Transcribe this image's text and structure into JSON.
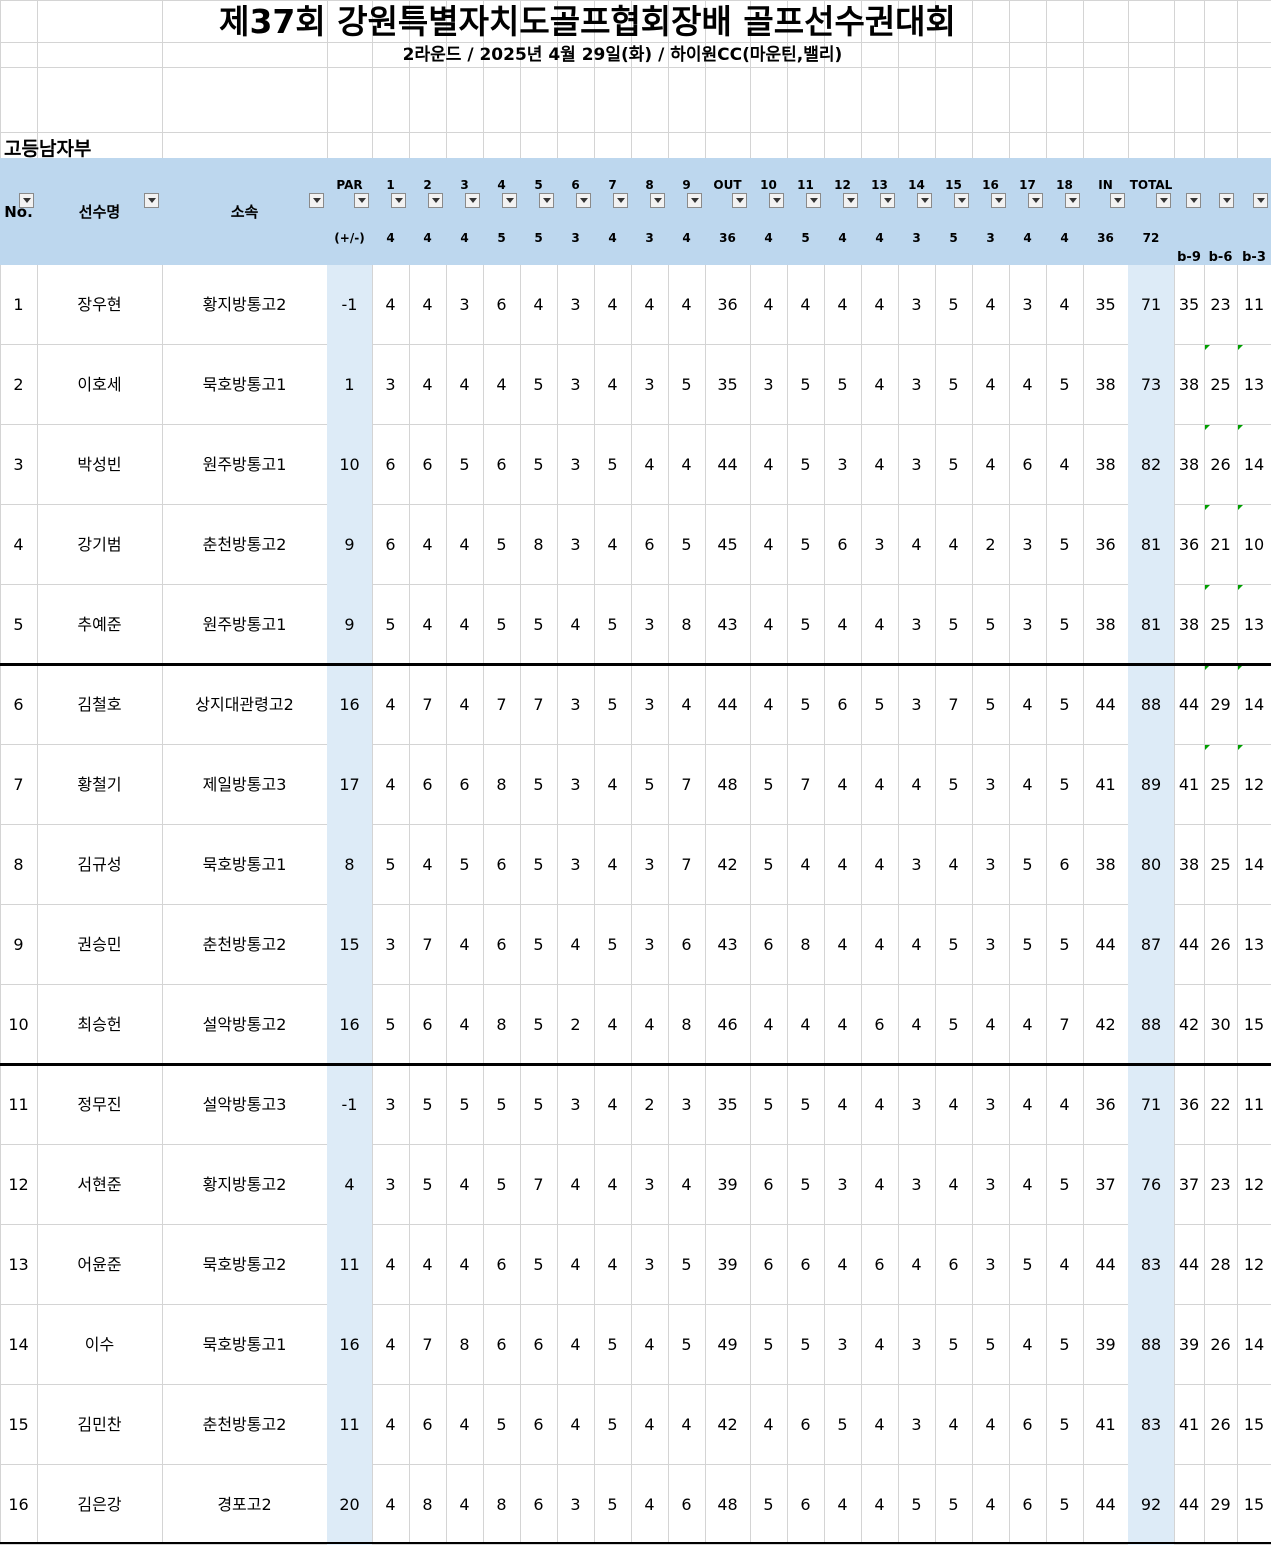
{
  "title": "제37회 강원특별자치도골프협회장배 골프선수권대회",
  "subtitle": "2라운드 / 2025년 4월 29일(화) / 하이원CC(마운틴,밸리)",
  "section": "고등남자부",
  "headers": {
    "no": "No.",
    "name": "선수명",
    "team": "소속",
    "par_top": "PAR",
    "par_bottom": "(+/-)",
    "holes_front": [
      "1",
      "2",
      "3",
      "4",
      "5",
      "6",
      "7",
      "8",
      "9"
    ],
    "out": "OUT",
    "holes_back": [
      "10",
      "11",
      "12",
      "13",
      "14",
      "15",
      "16",
      "17",
      "18"
    ],
    "in": "IN",
    "total": "TOTAL",
    "par_front": [
      "4",
      "4",
      "4",
      "5",
      "5",
      "3",
      "4",
      "3",
      "4"
    ],
    "par_out": "36",
    "par_back": [
      "4",
      "5",
      "4",
      "4",
      "3",
      "5",
      "3",
      "4",
      "4"
    ],
    "par_in": "36",
    "par_total": "72",
    "b9": "b-9",
    "b6": "b-6",
    "b3": "b-3"
  },
  "rows": [
    {
      "no": "1",
      "name": "장우현",
      "team": "황지방통고2",
      "par": "-1",
      "front": [
        "4",
        "4",
        "3",
        "6",
        "4",
        "3",
        "4",
        "4",
        "4"
      ],
      "out": "36",
      "back": [
        "4",
        "4",
        "4",
        "4",
        "3",
        "5",
        "4",
        "3",
        "4"
      ],
      "in": "35",
      "total": "71",
      "b9": "35",
      "b6": "23",
      "b3": "11"
    },
    {
      "no": "2",
      "name": "이호세",
      "team": "묵호방통고1",
      "par": "1",
      "front": [
        "3",
        "4",
        "4",
        "4",
        "5",
        "3",
        "4",
        "3",
        "5"
      ],
      "out": "35",
      "back": [
        "3",
        "5",
        "5",
        "4",
        "3",
        "5",
        "4",
        "4",
        "5"
      ],
      "in": "38",
      "total": "73",
      "b9": "38",
      "b6": "25",
      "b3": "13"
    },
    {
      "no": "3",
      "name": "박성빈",
      "team": "원주방통고1",
      "par": "10",
      "front": [
        "6",
        "6",
        "5",
        "6",
        "5",
        "3",
        "5",
        "4",
        "4"
      ],
      "out": "44",
      "back": [
        "4",
        "5",
        "3",
        "4",
        "3",
        "5",
        "4",
        "6",
        "4"
      ],
      "in": "38",
      "total": "82",
      "b9": "38",
      "b6": "26",
      "b3": "14"
    },
    {
      "no": "4",
      "name": "강기범",
      "team": "춘천방통고2",
      "par": "9",
      "front": [
        "6",
        "4",
        "4",
        "5",
        "8",
        "3",
        "4",
        "6",
        "5"
      ],
      "out": "45",
      "back": [
        "4",
        "5",
        "6",
        "3",
        "4",
        "4",
        "2",
        "3",
        "5"
      ],
      "in": "36",
      "total": "81",
      "b9": "36",
      "b6": "21",
      "b3": "10"
    },
    {
      "no": "5",
      "name": "추예준",
      "team": "원주방통고1",
      "par": "9",
      "front": [
        "5",
        "4",
        "4",
        "5",
        "5",
        "4",
        "5",
        "3",
        "8"
      ],
      "out": "43",
      "back": [
        "4",
        "5",
        "4",
        "4",
        "3",
        "5",
        "5",
        "3",
        "5"
      ],
      "in": "38",
      "total": "81",
      "b9": "38",
      "b6": "25",
      "b3": "13"
    },
    {
      "no": "6",
      "name": "김철호",
      "team": "상지대관령고2",
      "par": "16",
      "front": [
        "4",
        "7",
        "4",
        "7",
        "7",
        "3",
        "5",
        "3",
        "4"
      ],
      "out": "44",
      "back": [
        "4",
        "5",
        "6",
        "5",
        "3",
        "7",
        "5",
        "4",
        "5"
      ],
      "in": "44",
      "total": "88",
      "b9": "44",
      "b6": "29",
      "b3": "14"
    },
    {
      "no": "7",
      "name": "황철기",
      "team": "제일방통고3",
      "par": "17",
      "front": [
        "4",
        "6",
        "6",
        "8",
        "5",
        "3",
        "4",
        "5",
        "7"
      ],
      "out": "48",
      "back": [
        "5",
        "7",
        "4",
        "4",
        "4",
        "5",
        "3",
        "4",
        "5"
      ],
      "in": "41",
      "total": "89",
      "b9": "41",
      "b6": "25",
      "b3": "12"
    },
    {
      "no": "8",
      "name": "김규성",
      "team": "묵호방통고1",
      "par": "8",
      "front": [
        "5",
        "4",
        "5",
        "6",
        "5",
        "3",
        "4",
        "3",
        "7"
      ],
      "out": "42",
      "back": [
        "5",
        "4",
        "4",
        "4",
        "3",
        "4",
        "3",
        "5",
        "6"
      ],
      "in": "38",
      "total": "80",
      "b9": "38",
      "b6": "25",
      "b3": "14"
    },
    {
      "no": "9",
      "name": "권승민",
      "team": "춘천방통고2",
      "par": "15",
      "front": [
        "3",
        "7",
        "4",
        "6",
        "5",
        "4",
        "5",
        "3",
        "6"
      ],
      "out": "43",
      "back": [
        "6",
        "8",
        "4",
        "4",
        "4",
        "5",
        "3",
        "5",
        "5"
      ],
      "in": "44",
      "total": "87",
      "b9": "44",
      "b6": "26",
      "b3": "13"
    },
    {
      "no": "10",
      "name": "최승헌",
      "team": "설악방통고2",
      "par": "16",
      "front": [
        "5",
        "6",
        "4",
        "8",
        "5",
        "2",
        "4",
        "4",
        "8"
      ],
      "out": "46",
      "back": [
        "4",
        "4",
        "4",
        "6",
        "4",
        "5",
        "4",
        "4",
        "7"
      ],
      "in": "42",
      "total": "88",
      "b9": "42",
      "b6": "30",
      "b3": "15"
    },
    {
      "no": "11",
      "name": "정무진",
      "team": "설악방통고3",
      "par": "-1",
      "front": [
        "3",
        "5",
        "5",
        "5",
        "5",
        "3",
        "4",
        "2",
        "3"
      ],
      "out": "35",
      "back": [
        "5",
        "5",
        "4",
        "4",
        "3",
        "4",
        "3",
        "4",
        "4"
      ],
      "in": "36",
      "total": "71",
      "b9": "36",
      "b6": "22",
      "b3": "11"
    },
    {
      "no": "12",
      "name": "서현준",
      "team": "황지방통고2",
      "par": "4",
      "front": [
        "3",
        "5",
        "4",
        "5",
        "7",
        "4",
        "4",
        "3",
        "4"
      ],
      "out": "39",
      "back": [
        "6",
        "5",
        "3",
        "4",
        "3",
        "4",
        "3",
        "4",
        "5"
      ],
      "in": "37",
      "total": "76",
      "b9": "37",
      "b6": "23",
      "b3": "12"
    },
    {
      "no": "13",
      "name": "어윤준",
      "team": "묵호방통고2",
      "par": "11",
      "front": [
        "4",
        "4",
        "4",
        "6",
        "5",
        "4",
        "4",
        "3",
        "5"
      ],
      "out": "39",
      "back": [
        "6",
        "6",
        "4",
        "6",
        "4",
        "6",
        "3",
        "5",
        "4"
      ],
      "in": "44",
      "total": "83",
      "b9": "44",
      "b6": "28",
      "b3": "12"
    },
    {
      "no": "14",
      "name": "이수",
      "team": "묵호방통고1",
      "par": "16",
      "front": [
        "4",
        "7",
        "8",
        "6",
        "6",
        "4",
        "5",
        "4",
        "5"
      ],
      "out": "49",
      "back": [
        "5",
        "5",
        "3",
        "4",
        "3",
        "5",
        "5",
        "4",
        "5"
      ],
      "in": "39",
      "total": "88",
      "b9": "39",
      "b6": "26",
      "b3": "14"
    },
    {
      "no": "15",
      "name": "김민찬",
      "team": "춘천방통고2",
      "par": "11",
      "front": [
        "4",
        "6",
        "4",
        "5",
        "6",
        "4",
        "5",
        "4",
        "4"
      ],
      "out": "42",
      "back": [
        "4",
        "6",
        "5",
        "4",
        "3",
        "4",
        "4",
        "6",
        "5"
      ],
      "in": "41",
      "total": "83",
      "b9": "41",
      "b6": "26",
      "b3": "15"
    },
    {
      "no": "16",
      "name": "김은강",
      "team": "경포고2",
      "par": "20",
      "front": [
        "4",
        "8",
        "4",
        "8",
        "6",
        "3",
        "5",
        "4",
        "6"
      ],
      "out": "48",
      "back": [
        "5",
        "6",
        "4",
        "4",
        "5",
        "5",
        "4",
        "6",
        "5"
      ],
      "in": "44",
      "total": "92",
      "b9": "44",
      "b6": "29",
      "b3": "15"
    }
  ],
  "colors": {
    "header_bg": "#bdd7ee",
    "highlight_col": "#ddebf7",
    "gridline": "#d4d4d4",
    "error_marker": "#00a000"
  }
}
